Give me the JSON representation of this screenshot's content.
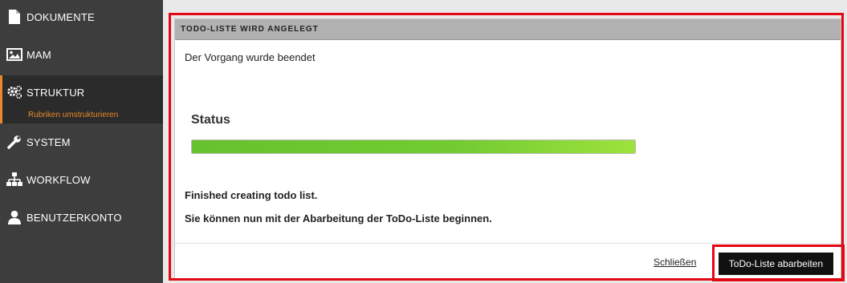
{
  "sidebar": {
    "items": [
      {
        "label": "DOKUMENTE",
        "icon": "document-icon"
      },
      {
        "label": "MAM",
        "icon": "image-icon"
      },
      {
        "label": "STRUKTUR",
        "icon": "gears-icon",
        "active": true,
        "subitems": [
          {
            "label": "Rubriken umstrukturieren"
          }
        ]
      },
      {
        "label": "SYSTEM",
        "icon": "wrench-icon"
      },
      {
        "label": "WORKFLOW",
        "icon": "sitemap-icon"
      },
      {
        "label": "BENUTZERKONTO",
        "icon": "user-icon"
      }
    ],
    "accent_color": "#e8892a"
  },
  "dialog": {
    "title": "TODO-LISTE WIRD ANGELEGT",
    "message": "Der Vorgang wurde beendet",
    "status_label": "Status",
    "progress": 1.0,
    "result_line_1": "Finished creating todo list.",
    "result_line_2": "Sie können nun mit der Abarbeitung der ToDo-Liste beginnen.",
    "close_label": "Schließen",
    "primary_label": "ToDo-Liste abarbeiten"
  },
  "highlight_color": "#e30613"
}
